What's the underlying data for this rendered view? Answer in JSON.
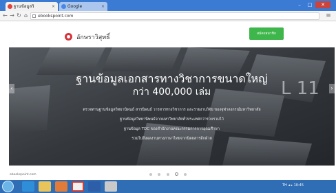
{
  "browser": {
    "tabs": [
      {
        "label": "ฐานข้อมูลวิ"
      },
      {
        "label": "Google"
      }
    ],
    "url": "ebookspoint.com"
  },
  "site": {
    "logo_text": "อักษราวิสุทธิ์",
    "cta_label": "สมัครสมาชิก"
  },
  "hero": {
    "title": "ฐานข้อมูลเอกสารทางวิชาการขนาดใหญ่",
    "subtitle": "กว่า 400,000 เล่ม",
    "lines": [
      "ตรวจทานฐานข้อมูลวิทยานิพนธ์ สารนิพนธ์ วารสารทางวิชาการ และรายงานวิจัย ของจุฬาลงกรณ์มหาวิทยาลัย",
      "ฐานข้อมูลวิทยานิพนธ์จากมหาวิทยาลัยทั่วประเทศกว่ารวบรวมไว้",
      "ฐานข้อมูล TDC ของสำนักงานคณะกรรมการการอุดมศึกษา",
      "รวมไปถึงผลงานทางภาษาไทยจากนิตยสารอีกด้วย"
    ],
    "active_slide": 3,
    "slide_count": 5,
    "tag_text": "L 11"
  },
  "status_url": "ebookspoint.com",
  "taskbar": {
    "tray_text": "TH ◂ ▸ 10:45"
  }
}
